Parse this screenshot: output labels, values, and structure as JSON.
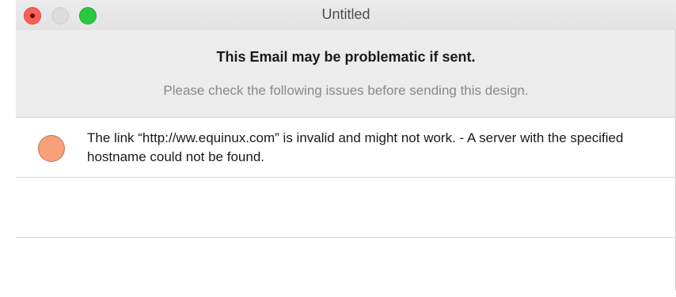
{
  "window": {
    "title": "Untitled"
  },
  "header": {
    "heading": "This Email may be problematic if sent.",
    "subheading": "Please check the following issues before sending this design."
  },
  "issues": [
    {
      "icon": "warning-dot-icon",
      "color": "#f7a07a",
      "text": "The link “http://ww.equinux.com” is invalid and might not work. - A server with the specified hostname could not be found."
    },
    {
      "text": ""
    },
    {
      "text": ""
    }
  ]
}
